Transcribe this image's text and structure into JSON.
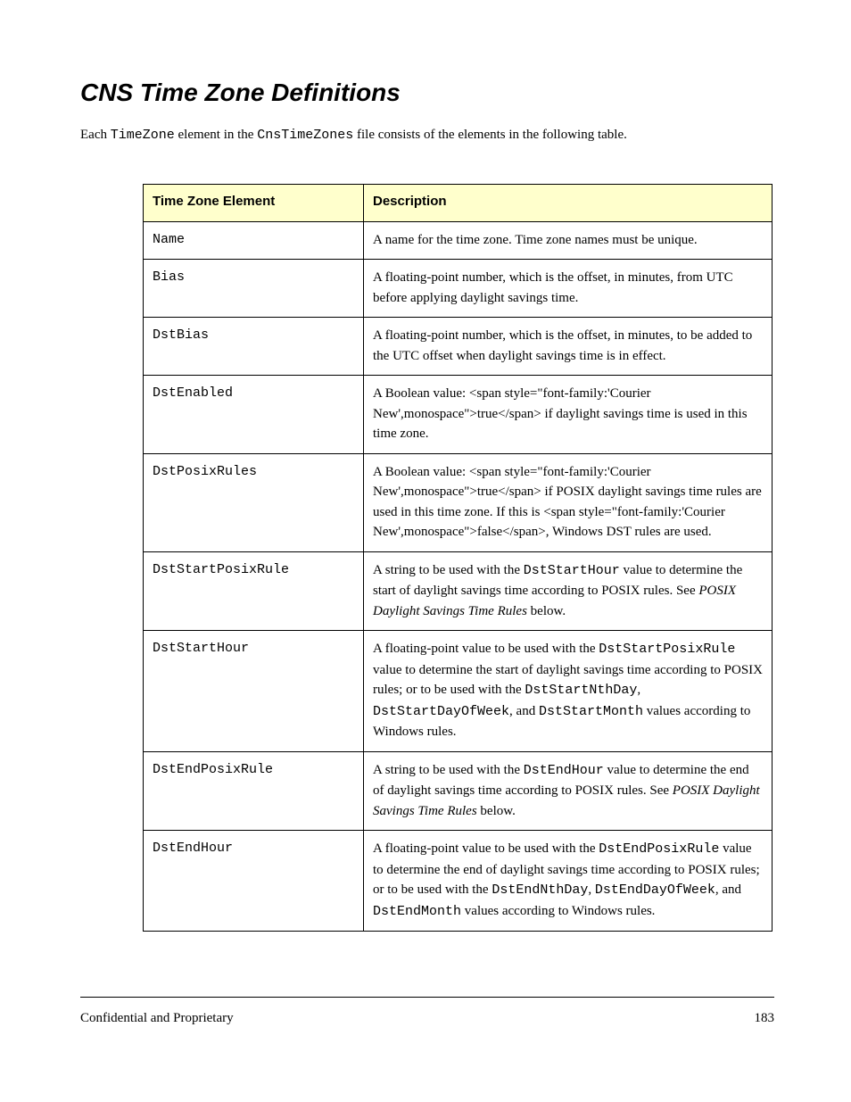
{
  "heading": "CNS Time Zone Definitions",
  "intro_html": "Each <span style=\"font-family:'Courier New',monospace\">TimeZone</span> element in the <span style=\"font-family:'Courier New',monospace\">CnsTimeZones</span> file consists of the elements in the following table.",
  "table": {
    "headers": [
      "Time Zone Element",
      "Description"
    ],
    "rows": [
      {
        "term": "Name",
        "def": "A name for the time zone. Time zone names must be unique."
      },
      {
        "term": "Bias",
        "def": "A floating-point number, which is the offset, in minutes, from UTC before applying daylight savings time."
      },
      {
        "term": "DstBias",
        "def": "A floating-point number, which is the offset, in minutes, to be added to the UTC offset when daylight savings time is in effect."
      },
      {
        "term": "DstEnabled",
        "def": "A Boolean value: <span style=\"font-family:'Courier New',monospace\">true</span> if daylight savings time is used in this time zone."
      },
      {
        "term": "DstPosixRules",
        "def": "A Boolean value: <span style=\"font-family:'Courier New',monospace\">true</span> if POSIX daylight savings time rules are used in this time zone. If this is <span style=\"font-family:'Courier New',monospace\">false</span>, Windows DST rules are used."
      },
      {
        "term": "DstStartPosixRule",
        "def_html": "A string to be used with the <span style=\"font-family:'Courier New',monospace\">DstStartHour</span> value to determine the start of daylight savings time according to POSIX rules. See <i>POSIX Daylight Savings Time Rules</i> below."
      },
      {
        "term": "DstStartHour",
        "def_html": "A floating-point value to be used with the <span style=\"font-family:'Courier New',monospace\">DstStartPosixRule</span> value to determine the start of daylight savings time according to POSIX rules; or to be used with the <span style=\"font-family:'Courier New',monospace\">DstStartNthDay</span>, <span style=\"font-family:'Courier New',monospace\">DstStartDayOfWeek</span>, and <span style=\"font-family:'Courier New',monospace\">DstStartMonth</span> values according to Windows rules."
      },
      {
        "term": "DstEndPosixRule",
        "def_html": "A string to be used with the <span style=\"font-family:'Courier New',monospace\">DstEndHour</span> value to determine the end of daylight savings time according to POSIX rules. See <i>POSIX Daylight Savings Time Rules</i> below."
      },
      {
        "term": "DstEndHour",
        "def_html": "A floating-point value to be used with the <span style=\"font-family:'Courier New',monospace\">DstEndPosixRule</span> value to determine the end of daylight savings time according to POSIX rules; or to be used with the <span style=\"font-family:'Courier New',monospace\">DstEndNthDay</span>, <span style=\"font-family:'Courier New',monospace\">DstEndDayOfWeek</span>, and <span style=\"font-family:'Courier New',monospace\">DstEndMonth</span> values according to Windows rules."
      }
    ]
  },
  "footer": {
    "left": "Confidential and Proprietary",
    "right": "183"
  }
}
